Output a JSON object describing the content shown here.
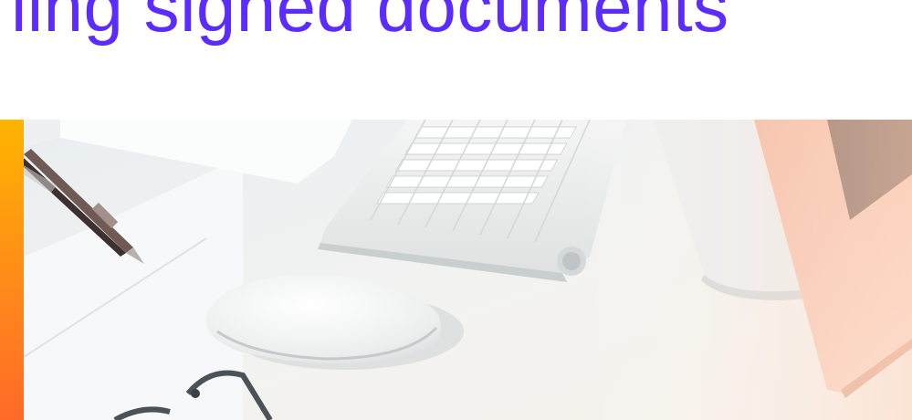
{
  "hero": {
    "headline": "ling signed documents",
    "accent_color": "#5b2bff",
    "accent_bar_colors": [
      "#ffb400",
      "#ff6a28"
    ]
  },
  "photo": {
    "depicts": [
      "paper-sheets",
      "pen",
      "keyboard",
      "mouse",
      "monitor",
      "laptop",
      "glasses"
    ]
  }
}
